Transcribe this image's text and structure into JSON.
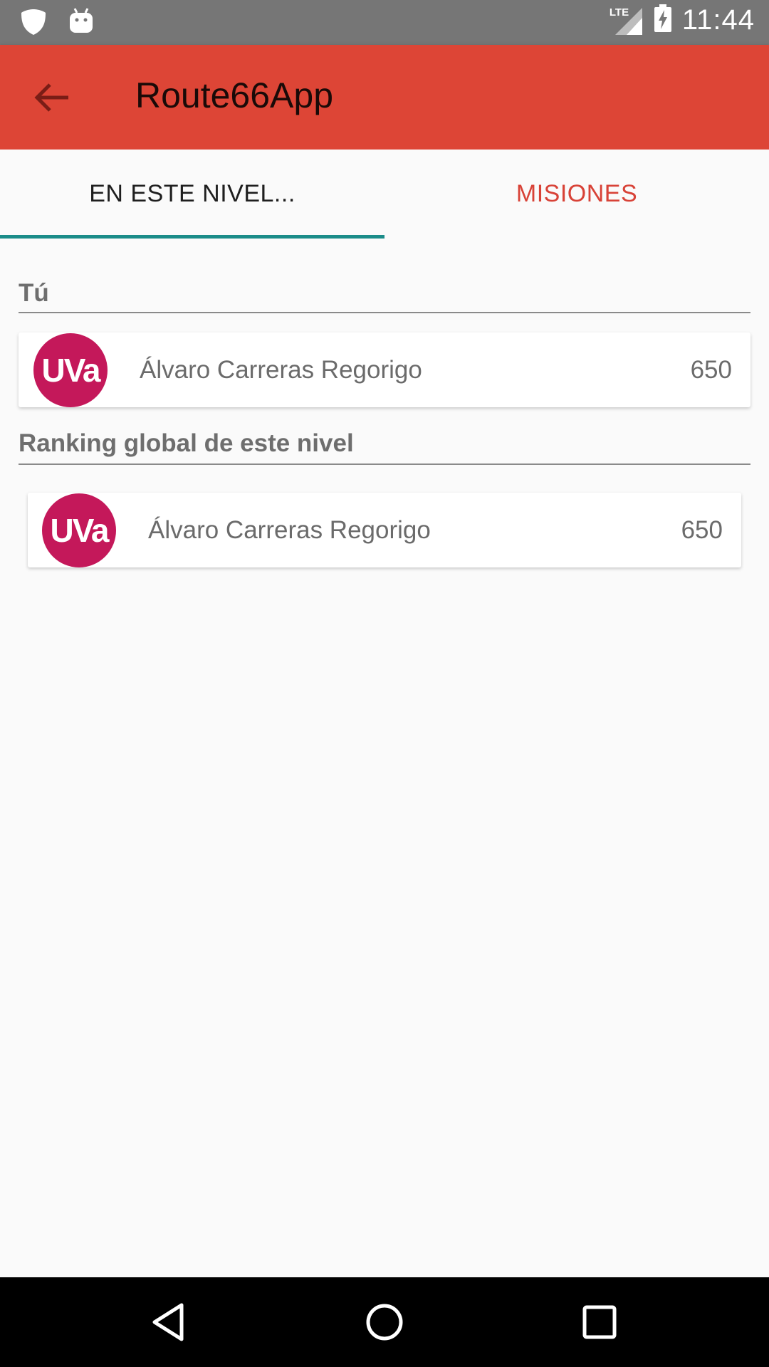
{
  "status_bar": {
    "time": "11:44",
    "network_label": "LTE",
    "icons": [
      "notification-shield-icon",
      "android-icon",
      "lte-signal-icon",
      "battery-charging-icon"
    ]
  },
  "app_bar": {
    "title": "Route66App",
    "back_icon": "arrow-back-icon",
    "color": "#dd4536"
  },
  "tabs": [
    {
      "label": "EN ESTE NIVEL...",
      "selected": true
    },
    {
      "label": "MISIONES",
      "selected": false
    }
  ],
  "accent": {
    "tab_indicator": "#1b8c89",
    "inactive_tab": "#d84237",
    "avatar": "#c4185a"
  },
  "you_section": {
    "title": "Tú",
    "entry": {
      "avatar_text": "UVa",
      "name": "Álvaro Carreras Regorigo",
      "score": "650"
    }
  },
  "ranking_section": {
    "title": "Ranking global de este nivel",
    "entries": [
      {
        "avatar_text": "UVa",
        "name": "Álvaro Carreras Regorigo",
        "score": "650"
      }
    ]
  },
  "nav_bar": {
    "icons": [
      "nav-back-icon",
      "nav-home-icon",
      "nav-recents-icon"
    ]
  }
}
